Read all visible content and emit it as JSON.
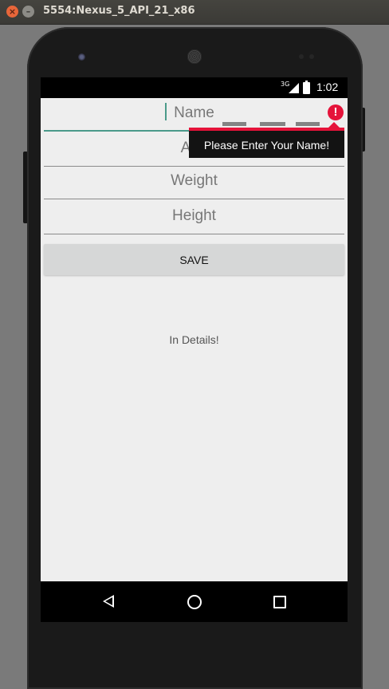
{
  "window": {
    "title": "5554:Nexus_5_API_21_x86",
    "close_glyph": "×",
    "minimize_glyph": "–"
  },
  "statusbar": {
    "network": "3G",
    "time": "1:02"
  },
  "form": {
    "name_placeholder": "Name",
    "age_placeholder": "Age",
    "weight_placeholder": "Weight",
    "height_placeholder": "Height",
    "error_icon_glyph": "!",
    "error_message": "Please Enter Your Name!",
    "save_label": "SAVE",
    "details_text": "In Details!"
  },
  "colors": {
    "accent": "#4a9a8a",
    "error": "#e5133a",
    "button": "#d6d7d7",
    "background": "#eeeeee"
  },
  "icons": [
    "close-icon",
    "minimize-icon",
    "signal-icon",
    "battery-icon",
    "error-icon",
    "back-icon",
    "home-icon",
    "recents-icon"
  ]
}
